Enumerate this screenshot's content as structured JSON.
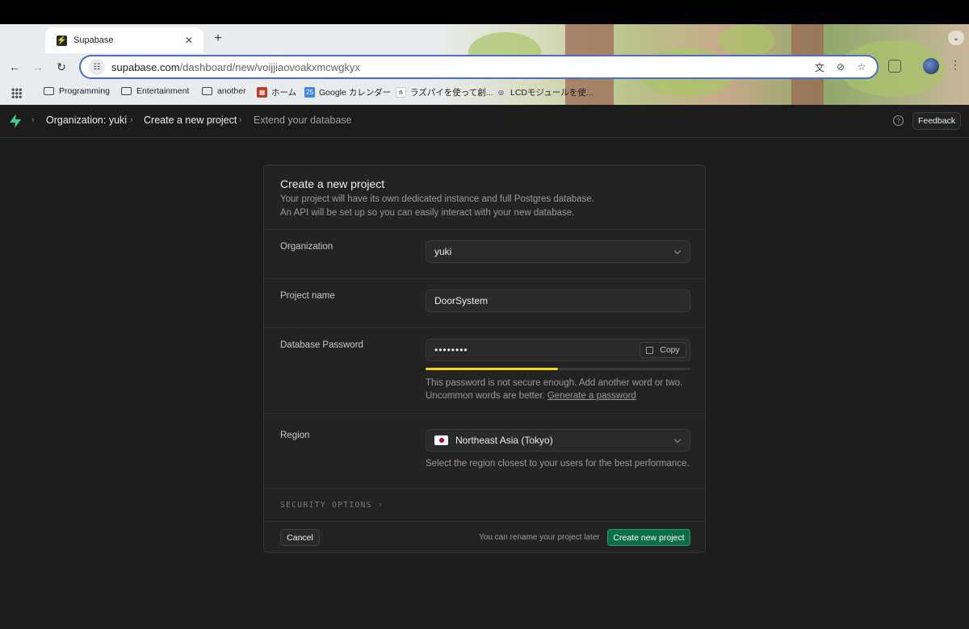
{
  "browser": {
    "tab": {
      "title": "Supabase",
      "favicon": "supabase-bolt-icon"
    },
    "url": {
      "domain": "supabase.com",
      "path": "/dashboard/new/voijjiaovoakxmcwgkyx"
    },
    "bookmarks": [
      {
        "label": "Programming",
        "icon": "folder-icon"
      },
      {
        "label": "Entertainment",
        "icon": "folder-icon"
      },
      {
        "label": "another",
        "icon": "folder-icon"
      },
      {
        "label": "ホーム",
        "icon": "site-favicon"
      },
      {
        "label": "Google カレンダー",
        "icon": "calendar-favicon"
      },
      {
        "label": "ラズパイを使って創...",
        "icon": "note-favicon"
      },
      {
        "label": "LCDモジュールを使...",
        "icon": "site-favicon"
      }
    ]
  },
  "app": {
    "breadcrumbs": [
      {
        "label": "Organization: yuki"
      },
      {
        "label": "Create a new project"
      },
      {
        "label": "Extend your database"
      }
    ],
    "feedback_label": "Feedback"
  },
  "form": {
    "title": "Create a new project",
    "description_line1": "Your project will have its own dedicated instance and full Postgres database.",
    "description_line2": "An API will be set up so you can easily interact with your new database.",
    "organization": {
      "label": "Organization",
      "value": "yuki"
    },
    "project_name": {
      "label": "Project name",
      "value": "DoorSystem"
    },
    "password": {
      "label": "Database Password",
      "masked_value": "••••••••",
      "copy_label": "Copy",
      "strength_fraction": 0.5,
      "strength_color": "#f5d90a",
      "hint": "This password is not secure enough. Add another word or two. Uncommon words are better.",
      "generate_link": "Generate a password"
    },
    "region": {
      "label": "Region",
      "value": "Northeast Asia (Tokyo)",
      "flag": "japan-flag-icon",
      "hint": "Select the region closest to your users for the best performance."
    },
    "security_options": "SECURITY OPTIONS",
    "footer": {
      "cancel_label": "Cancel",
      "rename_note": "You can rename your project later",
      "create_label": "Create new project"
    }
  },
  "colors": {
    "brand": "#3ecf8e",
    "primary_button": "#0b6e48",
    "background": "#1c1c1c",
    "card": "#232323"
  }
}
